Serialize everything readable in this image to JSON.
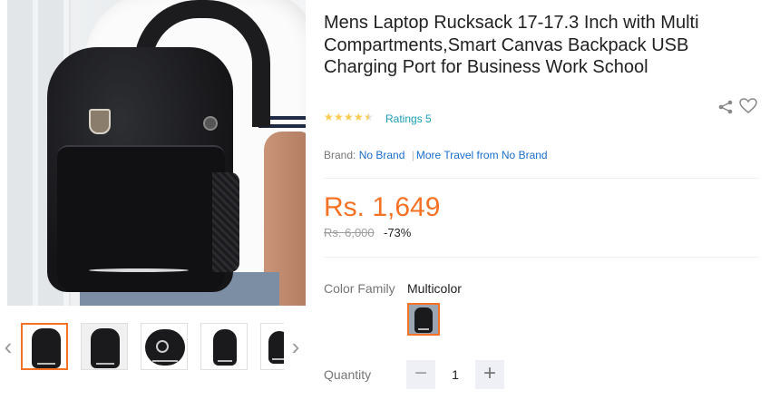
{
  "product": {
    "title": "Mens Laptop Rucksack 17-17.3 Inch with Multi Compartments,Smart Canvas Backpack USB Charging Port for Business Work School",
    "rating_stars": 4.5,
    "ratings_text": "Ratings 5",
    "brand_label": "Brand:",
    "brand_value": "No Brand",
    "brand_sep": "|",
    "more_from": "More Travel from No Brand",
    "price": "Rs. 1,649",
    "original_price": "Rs. 6,000",
    "discount": "-73%"
  },
  "icons": {
    "share": "share-icon",
    "wishlist": "heart-icon",
    "prev": "chevron-left-icon",
    "next": "chevron-right-icon"
  },
  "gallery": {
    "thumbnail_count": 5,
    "active_index": 0,
    "prev_arrow": "‹",
    "next_arrow": "›"
  },
  "options": {
    "color_label": "Color Family",
    "color_value": "Multicolor"
  },
  "quantity": {
    "label": "Quantity",
    "value": "1",
    "minus": "−",
    "plus": "+"
  },
  "colors": {
    "accent": "#f57224",
    "link": "#1a9cb7",
    "brand_link": "#1a6dcc",
    "star": "#faca51",
    "muted": "#757575"
  }
}
